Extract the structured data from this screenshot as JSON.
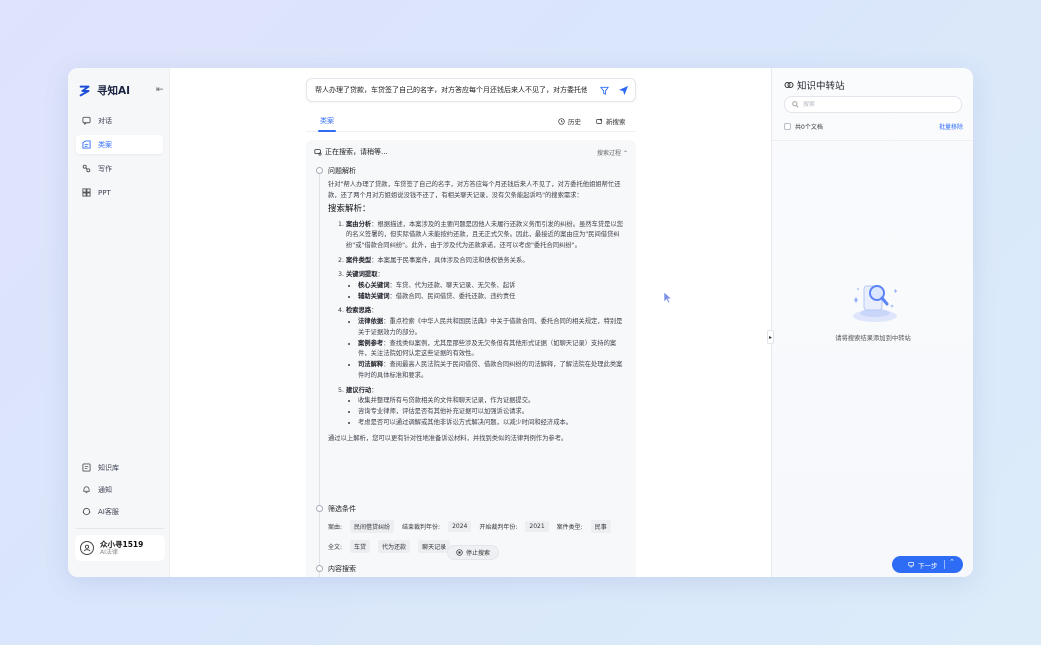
{
  "brand": {
    "name": "寻知AI"
  },
  "nav": {
    "top": [
      {
        "label": "对话",
        "icon": "chat-icon"
      },
      {
        "label": "类案",
        "icon": "case-icon"
      },
      {
        "label": "写作",
        "icon": "write-icon"
      },
      {
        "label": "PPT",
        "icon": "ppt-icon"
      }
    ],
    "bottom": [
      {
        "label": "知识库",
        "icon": "library-icon"
      },
      {
        "label": "通知",
        "icon": "bell-icon"
      },
      {
        "label": "AI客服",
        "icon": "support-icon"
      }
    ]
  },
  "user": {
    "name": "众小寻1519",
    "role": "AI法律"
  },
  "query": {
    "text": "帮人办理了贷款，车贷签了自己的名字，对方答应每个月还钱后来人不见了，对方委托他姐姐帮忙还款，还了两个月对方姐姐说没钱不还了，有相关聊天记录，没有欠条能起诉吗"
  },
  "tabs": {
    "active": "类案",
    "history": "历史",
    "new_search": "新搜索"
  },
  "status": {
    "searching": "正在搜索，请稍等...",
    "process_toggle": "搜索过程"
  },
  "steps": {
    "analysis_title": "问题解析",
    "filter_title": "筛选条件",
    "content_title": "内容搜索"
  },
  "analysis": {
    "intro": "针对\"帮人办理了贷款，车贷签了自己的名字，对方答应每个月还钱后来人不见了，对方委托他姐姐帮忙还款，还了两个月对方姐姐说没钱不还了，有相关聊天记录，没有欠条能起诉吗\"的搜索需求：",
    "heading": "搜索解析：",
    "items": [
      {
        "label": "案由分析",
        "text": "：根据描述，本案涉及的主要问题是因他人未履行还款义务而引发的纠纷。虽然车贷是以您的名义签署的，但实际借款人未能按约还款，且无正式欠条。因此，最接近的案由应为\"民间借贷纠纷\"或\"借款合同纠纷\"。此外，由于涉及代为还款承诺，还可以考虑\"委托合同纠纷\"。"
      },
      {
        "label": "案件类型",
        "text": "：本案属于民事案件，具体涉及合同法和债权债务关系。"
      },
      {
        "label": "关键词提取",
        "text": "：",
        "sub": [
          {
            "label": "核心关键词",
            "text": "：车贷、代为还款、聊天记录、无欠条、起诉"
          },
          {
            "label": "辅助关键词",
            "text": "：借款合同、民间借贷、委托还款、违约责任"
          }
        ]
      },
      {
        "label": "检索思路",
        "text": "：",
        "sub": [
          {
            "label": "法律依据",
            "text": "：重点检索《中华人民共和国民法典》中关于借款合同、委托合同的相关规定，特别是关于证据效力的部分。"
          },
          {
            "label": "案例参考",
            "text": "：查找类似案例，尤其是那些涉及无欠条但有其他形式证据（如聊天记录）支持的案件，关注法院如何认定这些证据的有效性。"
          },
          {
            "label": "司法解释",
            "text": "：查阅最高人民法院关于民间借贷、借款合同纠纷的司法解释，了解法院在处理此类案件时的具体标准和要求。"
          }
        ]
      },
      {
        "label": "建议行动",
        "text": "：",
        "sub": [
          {
            "label": "",
            "text": "收集并整理所有与贷款相关的文件和聊天记录，作为证据提交。"
          },
          {
            "label": "",
            "text": "咨询专业律师，评估是否有其他补充证据可以加强诉讼请求。"
          },
          {
            "label": "",
            "text": "考虑是否可以通过调解或其他非诉讼方式解决问题，以减少时间和经济成本。"
          }
        ]
      }
    ],
    "conclusion": "通过以上解析，您可以更有针对性地准备诉讼材料，并找到类似的法律判例作为参考。"
  },
  "filters": {
    "row1": [
      "案由:",
      "民间借贷纠纷",
      "结束裁判年份:",
      "2024",
      "开始裁判年份:",
      "2021",
      "案件类型:",
      "民事"
    ],
    "row2": [
      "全文:",
      "车贷",
      "代为还款",
      "聊天记录"
    ],
    "stop_label": "停止搜索"
  },
  "right_panel": {
    "title": "知识中转站",
    "search_placeholder": "搜索",
    "doc_count": "共0个文档",
    "batch_remove": "批量移除",
    "empty_text": "请将搜索结果添加到中转站",
    "next_label": "下一步"
  },
  "colors": {
    "accent": "#2f6cf6",
    "sidebar_bg": "#f6f7f9",
    "panel_bg": "#f7f8fa"
  }
}
